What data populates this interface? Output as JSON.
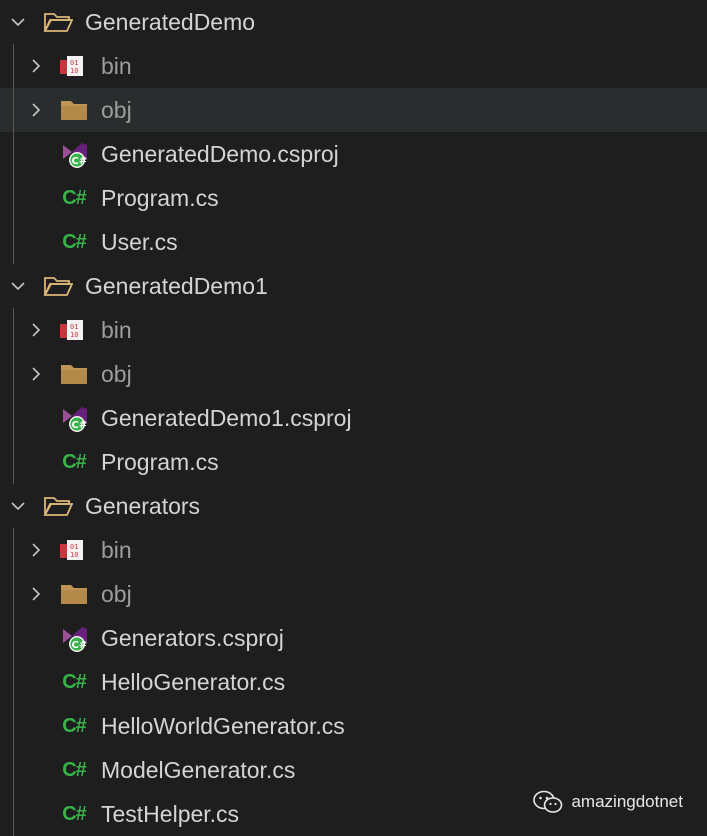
{
  "explorer": {
    "projects": [
      {
        "name": "GeneratedDemo",
        "expanded": true,
        "items": [
          {
            "label": "bin",
            "type": "bin-folder",
            "collapsed": true
          },
          {
            "label": "obj",
            "type": "folder",
            "collapsed": true
          },
          {
            "label": "GeneratedDemo.csproj",
            "type": "csproj"
          },
          {
            "label": "Program.cs",
            "type": "cs"
          },
          {
            "label": "User.cs",
            "type": "cs"
          }
        ]
      },
      {
        "name": "GeneratedDemo1",
        "expanded": true,
        "items": [
          {
            "label": "bin",
            "type": "bin-folder",
            "collapsed": true
          },
          {
            "label": "obj",
            "type": "folder",
            "collapsed": true
          },
          {
            "label": "GeneratedDemo1.csproj",
            "type": "csproj"
          },
          {
            "label": "Program.cs",
            "type": "cs"
          }
        ]
      },
      {
        "name": "Generators",
        "expanded": true,
        "items": [
          {
            "label": "bin",
            "type": "bin-folder",
            "collapsed": true
          },
          {
            "label": "obj",
            "type": "folder",
            "collapsed": true
          },
          {
            "label": "Generators.csproj",
            "type": "csproj"
          },
          {
            "label": "HelloGenerator.cs",
            "type": "cs"
          },
          {
            "label": "HelloWorldGenerator.cs",
            "type": "cs"
          },
          {
            "label": "ModelGenerator.cs",
            "type": "cs"
          },
          {
            "label": "TestHelper.cs",
            "type": "cs"
          }
        ]
      }
    ],
    "hovered_item": "obj"
  },
  "icons": {
    "chevron_expanded": "chevron-down-icon",
    "chevron_collapsed": "chevron-right-icon",
    "folder_open": "folder-open-icon",
    "folder": "folder-icon",
    "bin_folder": "binary-folder-icon",
    "csproj": "csproj-icon",
    "cs": "csharp-icon",
    "cs_glyph": "C#"
  },
  "colors": {
    "background": "#1e1e1e",
    "hover": "#2a2d2e",
    "text": "#d4d4d4",
    "dim_text": "#9d9d9d",
    "folder": "#c09553",
    "csharp": "#37b34a",
    "csproj_purple": "#68217a",
    "bin_red": "#c5383e"
  },
  "watermark": {
    "text": "amazingdotnet",
    "icon": "wechat-icon"
  }
}
